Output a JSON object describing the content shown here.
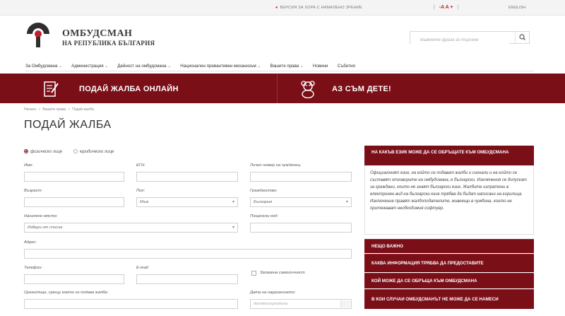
{
  "topbar": {
    "vision_label": "ВЕРСИЯ ЗА ХОРА С НАМАЛЕНО ЗРЕНИЕ",
    "font_controls": [
      "-A",
      "A",
      "+"
    ],
    "language": "ENGLISH"
  },
  "header": {
    "title": "ОМБУДСМАН",
    "subtitle": "НА РЕПУБЛИКА БЪЛГАРИЯ",
    "search_placeholder": "Въведете фраза за търсене"
  },
  "nav": {
    "items": [
      {
        "label": "За Омбудсмана",
        "dropdown": true
      },
      {
        "label": "Администрация",
        "dropdown": true
      },
      {
        "label": "Дейност на омбудсмана",
        "dropdown": true
      },
      {
        "label": "Национален превантивен механизъм",
        "dropdown": true
      },
      {
        "label": "Вашите права",
        "dropdown": true
      },
      {
        "label": "Новини",
        "dropdown": false
      },
      {
        "label": "Събития",
        "dropdown": false
      }
    ]
  },
  "banner": {
    "complaint": "ПОДАЙ ЖАЛБА ОНЛАЙН",
    "child": "АЗ СЪМ ДЕТЕ!"
  },
  "breadcrumb": [
    "Начало",
    "Вашите права",
    "Подай жалба"
  ],
  "page_title": "ПОДАЙ ЖАЛБА",
  "form": {
    "person_type": {
      "options": [
        "физическо лице",
        "юридическо лице"
      ],
      "selected": "физическо лице"
    },
    "labels": {
      "name": "Име:",
      "egn": "ЕГН:",
      "foreigner_id": "Личен номер на чужденец:",
      "age": "Възраст:",
      "gender": "Пол:",
      "citizenship": "Гражданство:",
      "settlement": "Населено място:",
      "postcode": "Пощенски код:",
      "address": "Адрес:",
      "phone": "Телефон:",
      "email": "E-mail:",
      "anonymity": "Запазена самоличност",
      "authority": "Орган/лице, срещу което се подава жалба:",
      "violation_date": "Дата на нарушението:"
    },
    "values": {
      "gender": "Мъж",
      "citizenship": "България",
      "settlement": "Избери от списък",
      "violation_date_placeholder": "ден/месец/година"
    }
  },
  "sidebar": {
    "heading": "НА КАКЪВ ЕЗИК МОЖЕ ДА СЕ ОБРЪЩАТЕ КЪМ ОМБУДСМАНА",
    "body": "Официалният език, на който се подават жалби и сигнали и на който се съставят отговорите на омбудсмана, е български. Изключения се допускат за граждани, които не знаят български език. Жалбите изпратени в електронен вид на български език трябва да бъдат написани на кирилица. Изключение правят жалбоподателите, живеещи в чужбина, които не притежават необходимия софтуер.",
    "items": [
      "НЕЩО ВАЖНО",
      "КАКВА ИНФОРМАЦИЯ ТРЯБВА ДА ПРЕДОСТАВИТЕ",
      "КОЙ МОЖЕ ДА СЕ ОБРЪЩА КЪМ ОМБУДСМАНА",
      "В КОИ СЛУЧАИ ОМБУДСМАНЪТ НЕ МОЖЕ ДА СЕ НАМЕСИ"
    ]
  },
  "colors": {
    "brand": "#7a0f18",
    "accent": "#c0202c"
  }
}
